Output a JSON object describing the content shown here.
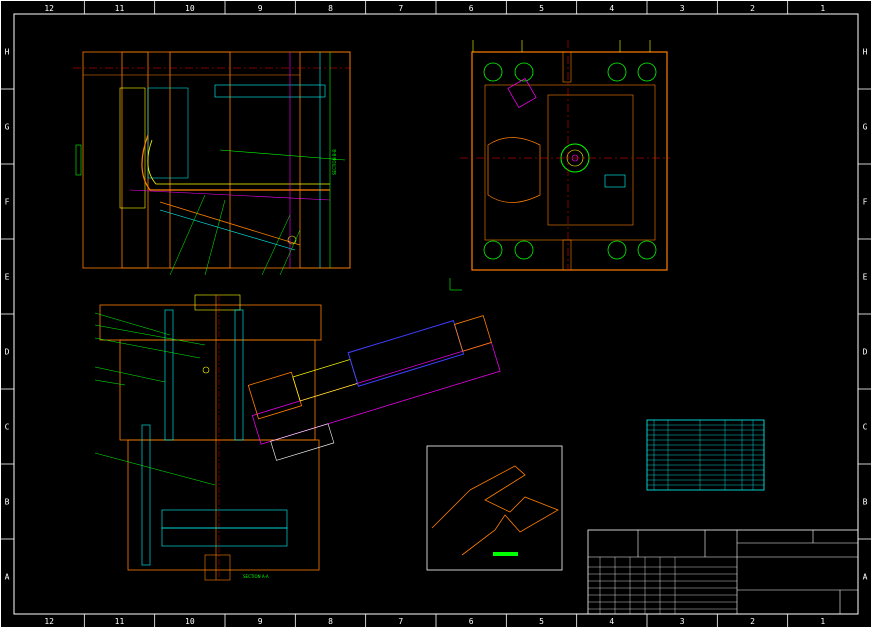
{
  "drawing": {
    "column_labels_top": [
      "12",
      "11",
      "10",
      "9",
      "8",
      "7",
      "6",
      "5",
      "4",
      "3",
      "2",
      "1"
    ],
    "column_labels_bottom": [
      "12",
      "11",
      "10",
      "9",
      "8",
      "7",
      "6",
      "5",
      "4",
      "3",
      "2",
      "1"
    ],
    "row_labels_left": [
      "H",
      "G",
      "F",
      "E",
      "D",
      "C",
      "B",
      "A"
    ],
    "row_labels_right": [
      "H",
      "G",
      "F",
      "E",
      "D",
      "C",
      "B",
      "A"
    ],
    "section_labels": {
      "side_view": "SECTION B-B",
      "front_view": "SECTION A-A"
    },
    "colors": {
      "background": "#000000",
      "frame": "#ffffff",
      "mold_plate": "#ff7f00",
      "cyan": "#00ffff",
      "green": "#00ff00",
      "yellow": "#ffff00",
      "magenta": "#ff00ff",
      "red": "#ff0000",
      "blue": "#3f3fff"
    },
    "icons": [
      "title-block",
      "bill-of-materials-table",
      "isometric-part-view",
      "zone-grid"
    ]
  }
}
